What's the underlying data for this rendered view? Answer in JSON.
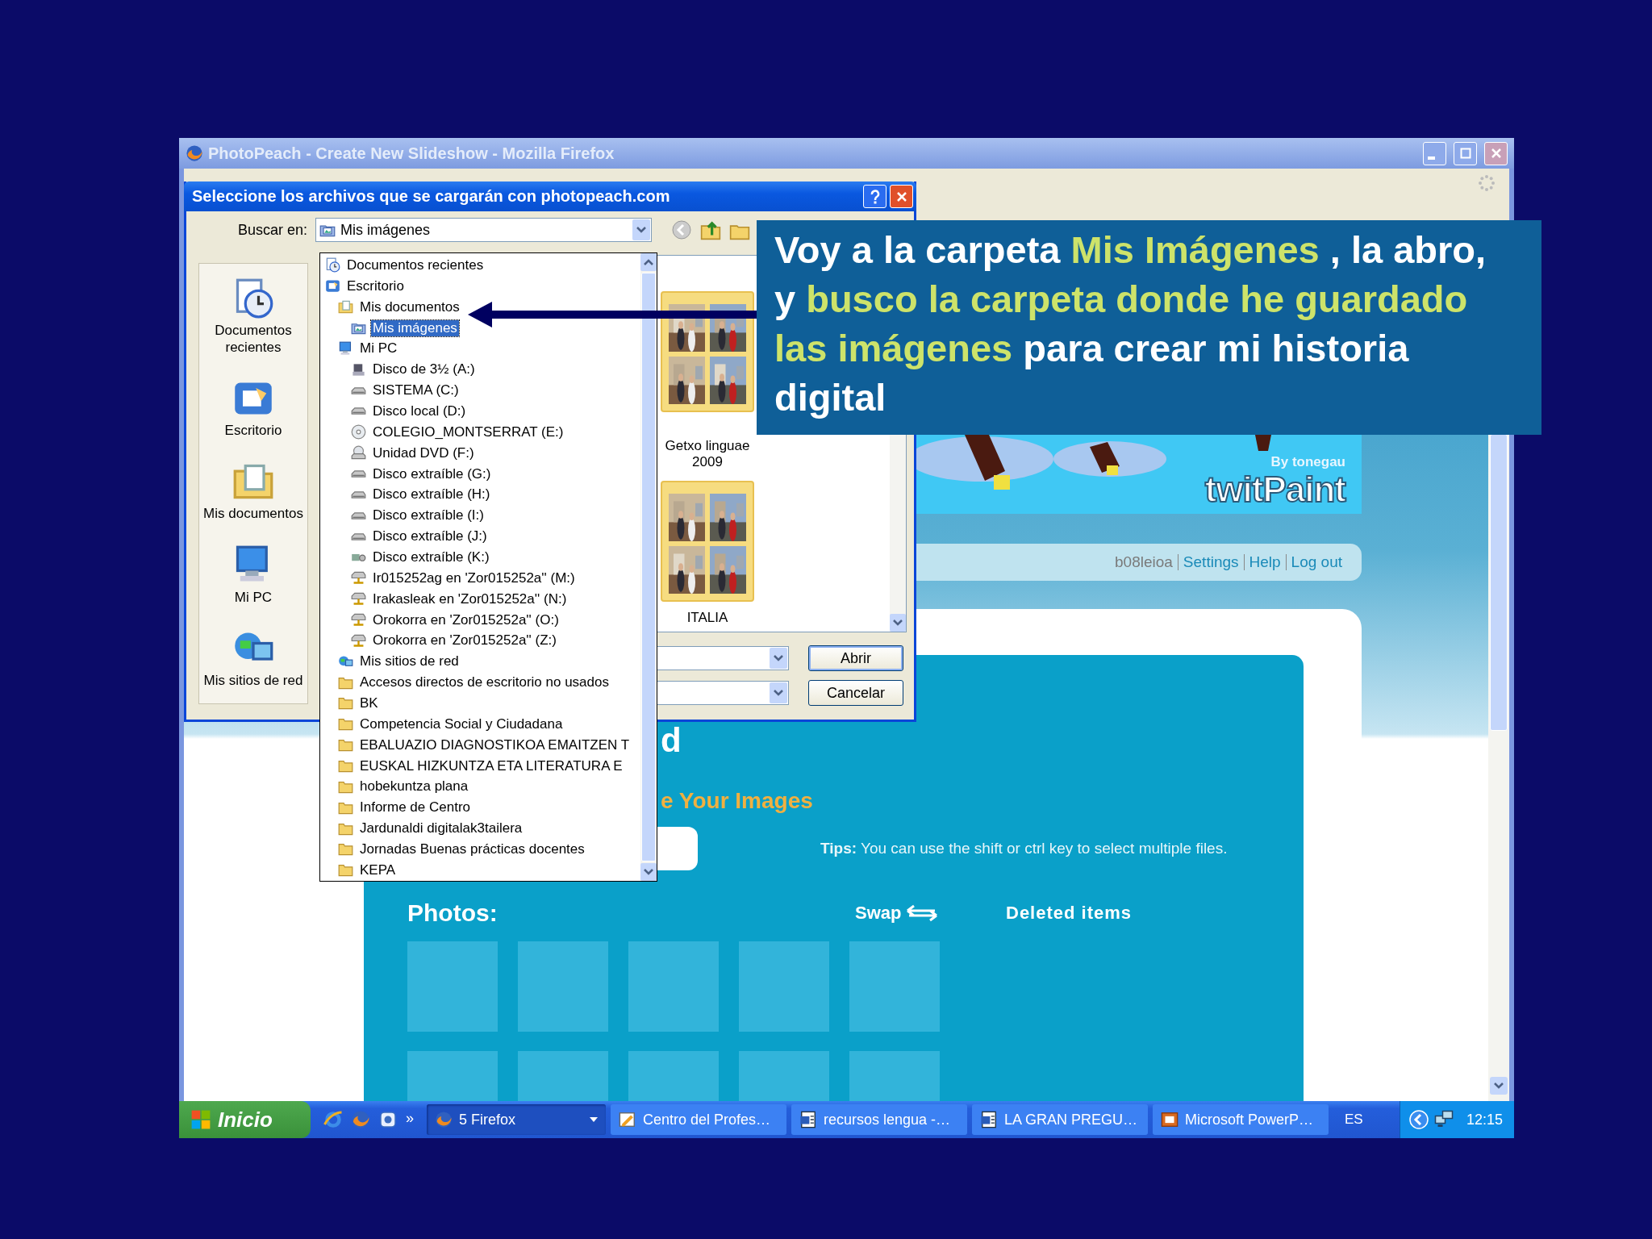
{
  "window": {
    "title": "PhotoPeach - Create New Slideshow - Mozilla Firefox"
  },
  "page": {
    "banner": {
      "credit": "By tonegau",
      "logo": "twitPaint"
    },
    "user": "b08leioa",
    "nav_links": [
      "Settings",
      "Help",
      "Log out"
    ],
    "heading_fragment": "d",
    "subheading_fragment": "e Your Images",
    "tips_label": "Tips:",
    "tips": "You can use the shift or ctrl key to select multiple files.",
    "photos_label": "Photos:",
    "swap": "Swap",
    "deleted": "Deleted items"
  },
  "dialog": {
    "title": "Seleccione los archivos que se cargarán con photopeach.com",
    "look_in_label": "Buscar en:",
    "look_in_value": "Mis imágenes",
    "places": [
      "Documentos recientes",
      "Escritorio",
      "Mis documentos",
      "Mi PC",
      "Mis sitios de red"
    ],
    "files": [
      {
        "name": "Getxo linguae 2009"
      },
      {
        "name": "ITALIA"
      }
    ],
    "buttons": [
      "Abrir",
      "Cancelar"
    ]
  },
  "dropdown": {
    "items": [
      {
        "label": "Documentos recientes",
        "kind": "recent",
        "selected": false
      },
      {
        "label": "Escritorio",
        "kind": "desktop",
        "selected": false,
        "children": [
          {
            "label": "Mis documentos",
            "kind": "docs",
            "selected": false,
            "children": [
              {
                "label": "Mis imágenes",
                "kind": "pictures",
                "selected": true
              }
            ]
          },
          {
            "label": "Mi PC",
            "kind": "pc",
            "selected": false,
            "children": [
              {
                "label": "Disco de 3½ (A:)",
                "kind": "floppy",
                "selected": false
              },
              {
                "label": "SISTEMA (C:)",
                "kind": "drive",
                "selected": false
              },
              {
                "label": "Disco local (D:)",
                "kind": "drive",
                "selected": false
              },
              {
                "label": "COLEGIO_MONTSERRAT (E:)",
                "kind": "cd",
                "selected": false
              },
              {
                "label": "Unidad DVD (F:)",
                "kind": "dvd",
                "selected": false
              },
              {
                "label": "Disco extraíble (G:)",
                "kind": "drive",
                "selected": false
              },
              {
                "label": "Disco extraíble (H:)",
                "kind": "drive",
                "selected": false
              },
              {
                "label": "Disco extraíble (I:)",
                "kind": "drive",
                "selected": false
              },
              {
                "label": "Disco extraíble (J:)",
                "kind": "drive",
                "selected": false
              },
              {
                "label": "Disco extraíble (K:)",
                "kind": "camera",
                "selected": false
              },
              {
                "label": "Ir015252ag en 'Zor015252a'' (M:)",
                "kind": "netdrive",
                "selected": false
              },
              {
                "label": "Irakasleak en 'Zor015252a'' (N:)",
                "kind": "netdrive",
                "selected": false
              },
              {
                "label": "Orokorra en 'Zor015252a'' (O:)",
                "kind": "netdrive",
                "selected": false
              },
              {
                "label": "Orokorra en 'Zor015252a'' (Z:)",
                "kind": "netdrive",
                "selected": false
              }
            ]
          },
          {
            "label": "Mis sitios de red",
            "kind": "network",
            "selected": false
          },
          {
            "label": "Accesos directos de escritorio no usados",
            "kind": "folder",
            "selected": false
          },
          {
            "label": "BK",
            "kind": "folder",
            "selected": false
          },
          {
            "label": "Competencia Social y Ciudadana",
            "kind": "folder",
            "selected": false
          },
          {
            "label": "EBALUAZIO DIAGNOSTIKOA EMAITZEN T",
            "kind": "folder",
            "selected": false
          },
          {
            "label": "EUSKAL HIZKUNTZA ETA LITERATURA E",
            "kind": "folder",
            "selected": false
          },
          {
            "label": "hobekuntza plana",
            "kind": "folder",
            "selected": false
          },
          {
            "label": "Informe de Centro",
            "kind": "folder",
            "selected": false
          },
          {
            "label": "Jardunaldi digitalak3tailera",
            "kind": "folder",
            "selected": false
          },
          {
            "label": "Jornadas Buenas prácticas docentes",
            "kind": "folder",
            "selected": false
          },
          {
            "label": "KEPA",
            "kind": "folder",
            "selected": false
          }
        ]
      }
    ]
  },
  "callout": {
    "segments": [
      {
        "text": "Voy a la carpeta ",
        "highlight": false
      },
      {
        "text": "Mis Imágenes",
        "highlight": true
      },
      {
        "text": " , la abro, y ",
        "highlight": false
      },
      {
        "text": "busco la carpeta donde he guardado las imágenes",
        "highlight": true
      },
      {
        "text": " para crear mi historia digital",
        "highlight": false
      }
    ]
  },
  "taskbar": {
    "start": "Inicio",
    "overflow": "»",
    "tasks": [
      {
        "label": "5 Firefox",
        "kind": "group",
        "selected": true
      },
      {
        "label": "Centro del Profes…",
        "kind": "window",
        "selected": false
      },
      {
        "label": "recursos lengua -…",
        "kind": "window",
        "selected": false
      },
      {
        "label": "LA GRAN PREGU…",
        "kind": "window",
        "selected": false
      },
      {
        "label": "Microsoft PowerP…",
        "kind": "window",
        "selected": false
      }
    ],
    "language": "ES",
    "clock": "12:15"
  }
}
